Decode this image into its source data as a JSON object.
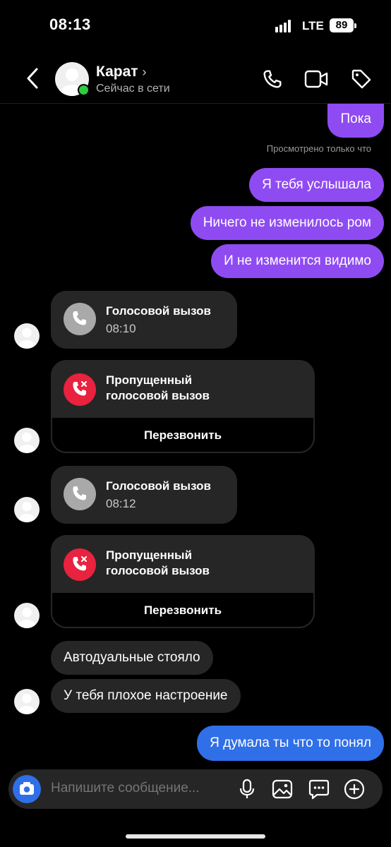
{
  "status_bar": {
    "time": "08:13",
    "network": "LTE",
    "battery": "89"
  },
  "header": {
    "contact_name": "Карат",
    "contact_status": "Сейчас в сети"
  },
  "messages": {
    "m1": "Пока",
    "seen": "Просмотрено только что",
    "m2": "Я тебя услышала",
    "m3": "Ничего не изменилось ром",
    "m4": "И не изменится видимо",
    "call1": {
      "title": "Голосовой вызов",
      "time": "08:10"
    },
    "missed1": {
      "title_line1": "Пропущенный",
      "title_line2": "голосовой вызов",
      "action": "Перезвонить"
    },
    "call2": {
      "title": "Голосовой вызов",
      "time": "08:12"
    },
    "missed2": {
      "title_line1": "Пропущенный",
      "title_line2": "голосовой вызов",
      "action": "Перезвонить"
    },
    "m5": "Автодуальные стояло",
    "m6": "У тебя плохое настроение",
    "m7": "Я думала ты что то понял"
  },
  "composer": {
    "placeholder": "Напишите сообщение..."
  },
  "colors": {
    "outgoing": "#8f4bf2",
    "outgoing_last": "#2f6fe8",
    "incoming": "#262626",
    "missed": "#e8223f"
  }
}
